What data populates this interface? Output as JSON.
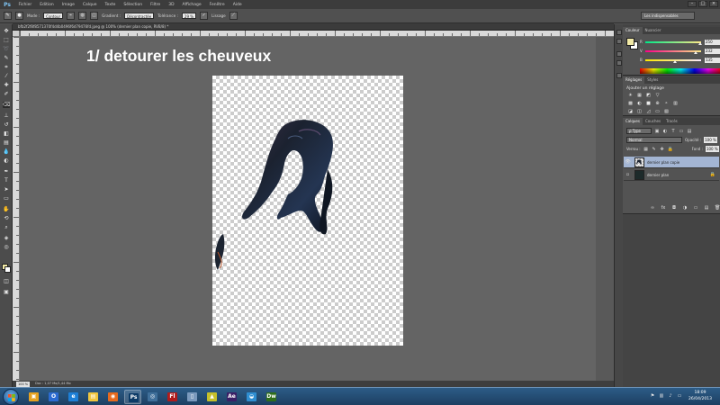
{
  "menubar": {
    "logo": "Ps",
    "items": [
      "Fichier",
      "Edition",
      "Image",
      "Calque",
      "Texte",
      "Sélection",
      "Filtre",
      "3D",
      "Affichage",
      "Fenêtre",
      "Aide"
    ],
    "window_controls": [
      "–",
      "□",
      "×"
    ]
  },
  "options": {
    "mode_label": "Mode :",
    "mode_value": "Contour",
    "shape_label": "Gradient :",
    "shape_value": "Décontractée",
    "tolerance_label": "Tolérance :",
    "tolerance_value": "29 %",
    "smooth_label": "Lissage",
    "workspace": "Les indispensables"
  },
  "document": {
    "tab_title": "bfb2f2f8f8571370f4d4b0496f6d79476fd.jpeg @ 100% (dernier plan copie, RVB/8) *",
    "zoom": "100 %",
    "status": "Doc : 1,07 Mo/1,44 Mo",
    "annotation": "1/ detourer les cheuveux"
  },
  "colors": {
    "foreground": "#f1e9a6",
    "background": "#ffffff",
    "pasteboard": "#646464"
  },
  "color_panel": {
    "tabs": [
      "Couleur",
      "Nuancier"
    ],
    "sliders": [
      {
        "name": "R",
        "value": "250",
        "fraction": 0.98
      },
      {
        "name": "V",
        "value": "232",
        "fraction": 0.91
      },
      {
        "name": "B",
        "value": "135",
        "fraction": 0.53
      }
    ]
  },
  "adjustments_panel": {
    "tabs": [
      "Réglages",
      "Styles"
    ],
    "title": "Ajouter un réglage",
    "icons_row1": [
      "☀",
      "▦",
      "◩",
      "▽"
    ],
    "icons_row2": [
      "▩",
      "◐",
      "■",
      "⊕",
      "⚬",
      "▥"
    ],
    "icons_row3": [
      "◪",
      "◫",
      "◿",
      "▭",
      "▧"
    ]
  },
  "layers_panel": {
    "tabs": [
      "Calques",
      "Couches",
      "Tracés"
    ],
    "kind": "ρ Type",
    "blend_mode": "Normal",
    "opacity_label": "Opacité :",
    "opacity_value": "100 %",
    "lock_label": "Verrou :",
    "fill_label": "Fond :",
    "fill_value": "100 %",
    "layers": [
      {
        "name": "dernier plan copie",
        "visible": true,
        "selected": true
      },
      {
        "name": "dernier plan",
        "visible": false,
        "selected": false
      }
    ],
    "footer_icons": [
      "∞",
      "fx",
      "◘",
      "◑",
      "▭",
      "▤",
      "🗑"
    ]
  },
  "taskbar": {
    "apps": [
      {
        "glyph": "▣",
        "color": "#e5a221"
      },
      {
        "glyph": "O",
        "color": "#2b6bd1"
      },
      {
        "glyph": "e",
        "color": "#1d7fd6"
      },
      {
        "glyph": "▤",
        "color": "#f0c640"
      },
      {
        "glyph": "◉",
        "color": "#e66a1e"
      },
      {
        "glyph": "Ps",
        "color": "#0b3a66"
      },
      {
        "glyph": "◎",
        "color": "#3f6f9a"
      },
      {
        "glyph": "Fl",
        "color": "#b01b1b"
      },
      {
        "glyph": "▯",
        "color": "#7a99bd"
      },
      {
        "glyph": "▲",
        "color": "#c5c02a"
      },
      {
        "glyph": "Ae",
        "color": "#3a1f66"
      },
      {
        "glyph": "◒",
        "color": "#2f8ed1"
      },
      {
        "glyph": "Dw",
        "color": "#2f6e1a"
      }
    ],
    "time": "18:09",
    "date": "26/04/2013"
  }
}
